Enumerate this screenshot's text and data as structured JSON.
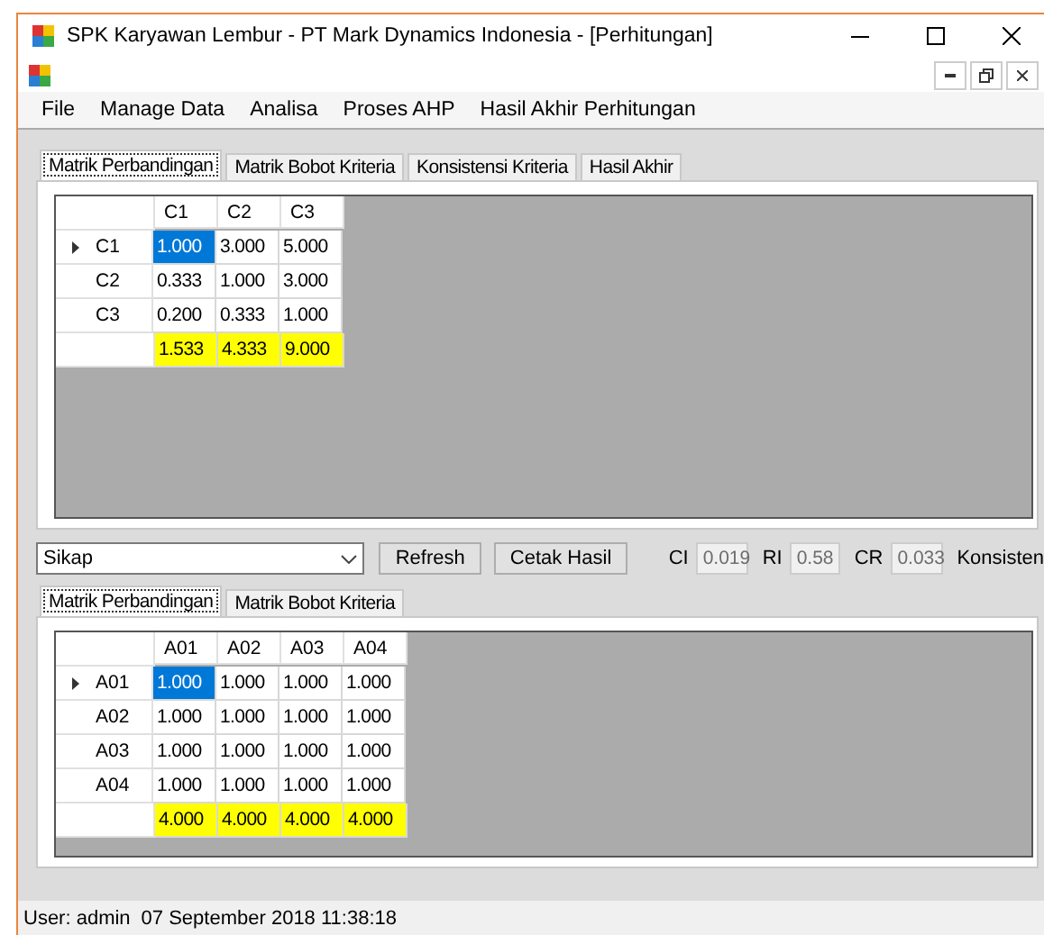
{
  "window": {
    "title": "SPK Karyawan Lembur - PT Mark Dynamics Indonesia - [Perhitungan]"
  },
  "menu": [
    "File",
    "Manage Data",
    "Analisa",
    "Proses AHP",
    "Hasil Akhir Perhitungan"
  ],
  "top_tabs": [
    {
      "label": "Matrik Perbandingan",
      "selected": true
    },
    {
      "label": "Matrik Bobot Kriteria",
      "selected": false
    },
    {
      "label": "Konsistensi Kriteria",
      "selected": false
    },
    {
      "label": "Hasil Akhir",
      "selected": false
    }
  ],
  "criteria_grid": {
    "columns": [
      "C1",
      "C2",
      "C3"
    ],
    "rows": [
      {
        "header": "C1",
        "current": true,
        "cells": [
          {
            "value": "1.000",
            "selected": true
          },
          {
            "value": "3.000",
            "selected": false
          },
          {
            "value": "5.000",
            "selected": false
          }
        ]
      },
      {
        "header": "C2",
        "current": false,
        "cells": [
          {
            "value": "0.333",
            "selected": false
          },
          {
            "value": "1.000",
            "selected": false
          },
          {
            "value": "3.000",
            "selected": false
          }
        ]
      },
      {
        "header": "C3",
        "current": false,
        "cells": [
          {
            "value": "0.200",
            "selected": false
          },
          {
            "value": "0.333",
            "selected": false
          },
          {
            "value": "1.000",
            "selected": false
          }
        ]
      }
    ],
    "totals": [
      "1.533",
      "4.333",
      "9.000"
    ]
  },
  "controls": {
    "criterion_select": "Sikap",
    "buttons": [
      "Refresh",
      "Cetak Hasil"
    ],
    "readings": [
      {
        "label": "CI",
        "value": "0.019"
      },
      {
        "label": "RI",
        "value": "0.58"
      },
      {
        "label": "CR",
        "value": "0.033"
      }
    ],
    "result": "Konsisten"
  },
  "bottom_tabs": [
    {
      "label": "Matrik Perbandingan",
      "selected": true
    },
    {
      "label": "Matrik Bobot Kriteria",
      "selected": false
    }
  ],
  "alternatives_grid": {
    "columns": [
      "A01",
      "A02",
      "A03",
      "A04"
    ],
    "rows": [
      {
        "header": "A01",
        "current": true,
        "cells": [
          {
            "value": "1.000",
            "selected": true
          },
          {
            "value": "1.000",
            "selected": false
          },
          {
            "value": "1.000",
            "selected": false
          },
          {
            "value": "1.000",
            "selected": false
          }
        ]
      },
      {
        "header": "A02",
        "current": false,
        "cells": [
          {
            "value": "1.000",
            "selected": false
          },
          {
            "value": "1.000",
            "selected": false
          },
          {
            "value": "1.000",
            "selected": false
          },
          {
            "value": "1.000",
            "selected": false
          }
        ]
      },
      {
        "header": "A03",
        "current": false,
        "cells": [
          {
            "value": "1.000",
            "selected": false
          },
          {
            "value": "1.000",
            "selected": false
          },
          {
            "value": "1.000",
            "selected": false
          },
          {
            "value": "1.000",
            "selected": false
          }
        ]
      },
      {
        "header": "A04",
        "current": false,
        "cells": [
          {
            "value": "1.000",
            "selected": false
          },
          {
            "value": "1.000",
            "selected": false
          },
          {
            "value": "1.000",
            "selected": false
          },
          {
            "value": "1.000",
            "selected": false
          }
        ]
      }
    ],
    "totals": [
      "4.000",
      "4.000",
      "4.000",
      "4.000"
    ]
  },
  "status_bar": {
    "user": "User: admin",
    "datetime": "07 September 2018 11:38:18"
  }
}
